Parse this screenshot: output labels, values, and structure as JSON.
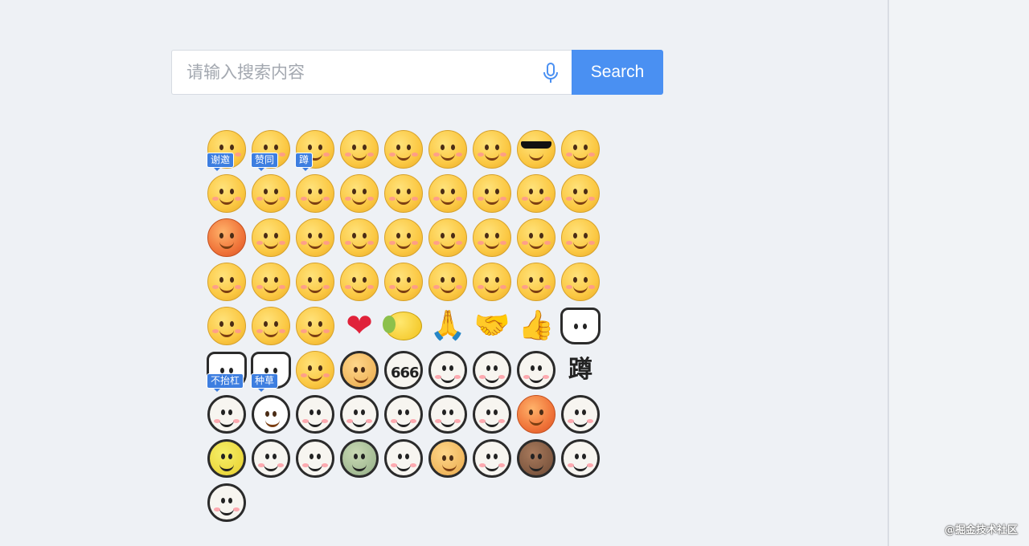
{
  "search": {
    "placeholder": "请输入搜索内容",
    "button_label": "Search",
    "accent_color": "#4a90f2"
  },
  "emoji_panel": {
    "items": [
      {
        "name": "emoji-thanks-icon",
        "style": "y",
        "label": "谢邀"
      },
      {
        "name": "emoji-agree-icon",
        "style": "y",
        "label": "赞同"
      },
      {
        "name": "emoji-squat-icon",
        "style": "y",
        "label": "蹲"
      },
      {
        "name": "emoji-kiss-wink-icon",
        "style": "y"
      },
      {
        "name": "emoji-shy-icon",
        "style": "y"
      },
      {
        "name": "emoji-confused-icon",
        "style": "y"
      },
      {
        "name": "emoji-thinking-icon",
        "style": "y"
      },
      {
        "name": "emoji-cool-sunglasses-icon",
        "style": "y",
        "kind": "glasses"
      },
      {
        "name": "emoji-grin-icon",
        "style": "y"
      },
      {
        "name": "emoji-smile-icon",
        "style": "y"
      },
      {
        "name": "emoji-facepalm-icon",
        "style": "y"
      },
      {
        "name": "emoji-giggle-icon",
        "style": "y"
      },
      {
        "name": "emoji-rofl-icon",
        "style": "y"
      },
      {
        "name": "emoji-victory-icon",
        "style": "y"
      },
      {
        "name": "emoji-starstruck-icon",
        "style": "y"
      },
      {
        "name": "emoji-excited-icon",
        "style": "y"
      },
      {
        "name": "emoji-sweat-cry-icon",
        "style": "y"
      },
      {
        "name": "emoji-sob-icon",
        "style": "y"
      },
      {
        "name": "emoji-angry-icon",
        "style": "r"
      },
      {
        "name": "emoji-scream-icon",
        "style": "y"
      },
      {
        "name": "emoji-pleading-icon",
        "style": "y"
      },
      {
        "name": "emoji-unamused-icon",
        "style": "y"
      },
      {
        "name": "emoji-stare-icon",
        "style": "y"
      },
      {
        "name": "emoji-smirk-icon",
        "style": "y"
      },
      {
        "name": "emoji-shush-icon",
        "style": "y"
      },
      {
        "name": "emoji-cold-sweat-icon",
        "style": "y"
      },
      {
        "name": "emoji-blush-hands-icon",
        "style": "y"
      },
      {
        "name": "emoji-awkward-icon",
        "style": "y"
      },
      {
        "name": "emoji-watermelon-icon",
        "style": "y"
      },
      {
        "name": "emoji-meh-icon",
        "style": "y"
      },
      {
        "name": "emoji-sad-icon",
        "style": "y"
      },
      {
        "name": "emoji-skeptical-icon",
        "style": "y"
      },
      {
        "name": "emoji-relieved-icon",
        "style": "y"
      },
      {
        "name": "emoji-diving-mask-icon",
        "style": "y"
      },
      {
        "name": "emoji-mask-icon",
        "style": "y"
      },
      {
        "name": "emoji-laugh-icon",
        "style": "y"
      },
      {
        "name": "emoji-eye-roll-icon",
        "style": "y"
      },
      {
        "name": "emoji-joy-icon",
        "style": "y"
      },
      {
        "name": "emoji-look-up-icon",
        "style": "y"
      },
      {
        "name": "heart-icon",
        "kind": "heart"
      },
      {
        "name": "lemon-icon",
        "kind": "lemon"
      },
      {
        "name": "pray-icon",
        "kind": "hand",
        "glyph": "🙏"
      },
      {
        "name": "handshake-icon",
        "kind": "hand",
        "glyph": "🤝"
      },
      {
        "name": "thumbs-up-icon",
        "kind": "hand",
        "glyph": "👍"
      },
      {
        "name": "panda-cat-icon",
        "kind": "cat"
      },
      {
        "name": "cat-no-argue-icon",
        "kind": "cat",
        "label": "不抬杠"
      },
      {
        "name": "cat-grass-icon",
        "kind": "cat",
        "label": "种草"
      },
      {
        "name": "emoji-love-heart-icon",
        "style": "y"
      },
      {
        "name": "doge-icon",
        "style": "dog"
      },
      {
        "name": "emoji-666-icon",
        "style": "w",
        "kind": "666",
        "text": "666"
      },
      {
        "name": "emoji-dizzy-glasses-icon",
        "style": "w"
      },
      {
        "name": "emoji-tongue-icon",
        "style": "w"
      },
      {
        "name": "emoji-injured-icon",
        "style": "w"
      },
      {
        "name": "emoji-squat-char-icon",
        "kind": "char",
        "text": "蹲"
      },
      {
        "name": "emoji-lips-icon",
        "style": "w"
      },
      {
        "name": "husky-icon",
        "style": "husky"
      },
      {
        "name": "emoji-cheer-icon",
        "style": "w"
      },
      {
        "name": "emoji-bangs-icon",
        "style": "w"
      },
      {
        "name": "emoji-teary-icon",
        "style": "w"
      },
      {
        "name": "emoji-squint-icon",
        "style": "w"
      },
      {
        "name": "emoji-smug-icon",
        "style": "w"
      },
      {
        "name": "emoji-furious-icon",
        "style": "r"
      },
      {
        "name": "emoji-wry-icon",
        "style": "w"
      },
      {
        "name": "emoji-sick-icon",
        "style": "lime"
      },
      {
        "name": "emoji-side-eye-icon",
        "style": "w"
      },
      {
        "name": "emoji-old-man-icon",
        "style": "w"
      },
      {
        "name": "emoji-nosebleed-icon",
        "style": "g"
      },
      {
        "name": "emoji-sparkle-eyes-icon",
        "style": "w"
      },
      {
        "name": "emoji-shiba-icon",
        "style": "dog"
      },
      {
        "name": "emoji-sparkle-thumb-icon",
        "style": "w"
      },
      {
        "name": "emoji-tan-face-icon",
        "style": "b"
      },
      {
        "name": "emoji-dizzy-icon",
        "style": "w"
      },
      {
        "name": "emoji-blank-stare-icon",
        "style": "w"
      }
    ]
  },
  "watermark": "@掘金技术社区"
}
